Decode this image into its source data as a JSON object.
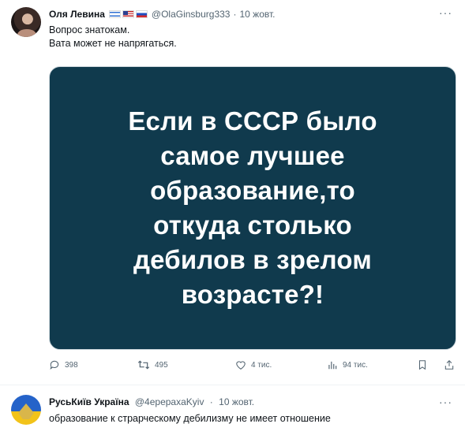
{
  "tweet": {
    "author_name": "Оля Левина",
    "handle": "@OlaGinsburg333",
    "separator": "·",
    "date": "10 жовт.",
    "more_label": "···",
    "text_line1": "Вопрос знатокам.",
    "text_line2": "Вата может не напрягаться.",
    "flags": [
      "israel-flag-icon",
      "usa-flag-icon",
      "russia-flag-icon"
    ],
    "image_text": "Если в СССР было\nсамое лучшее\nобразование,то\nоткуда столько\nдебилов в зрелом\nвозрасте?!",
    "image_bg": "#103a4d",
    "actions": {
      "replies": "398",
      "retweets": "495",
      "likes": "4 тис.",
      "views": "94 тис."
    }
  },
  "reply": {
    "author_name": "РусьКиїв Україна",
    "handle": "@4eрepaxaKyiv",
    "separator": "·",
    "date": "10 жовт.",
    "more_label": "···",
    "text": "образование к страрческому дебилизму не имеет отношение"
  }
}
